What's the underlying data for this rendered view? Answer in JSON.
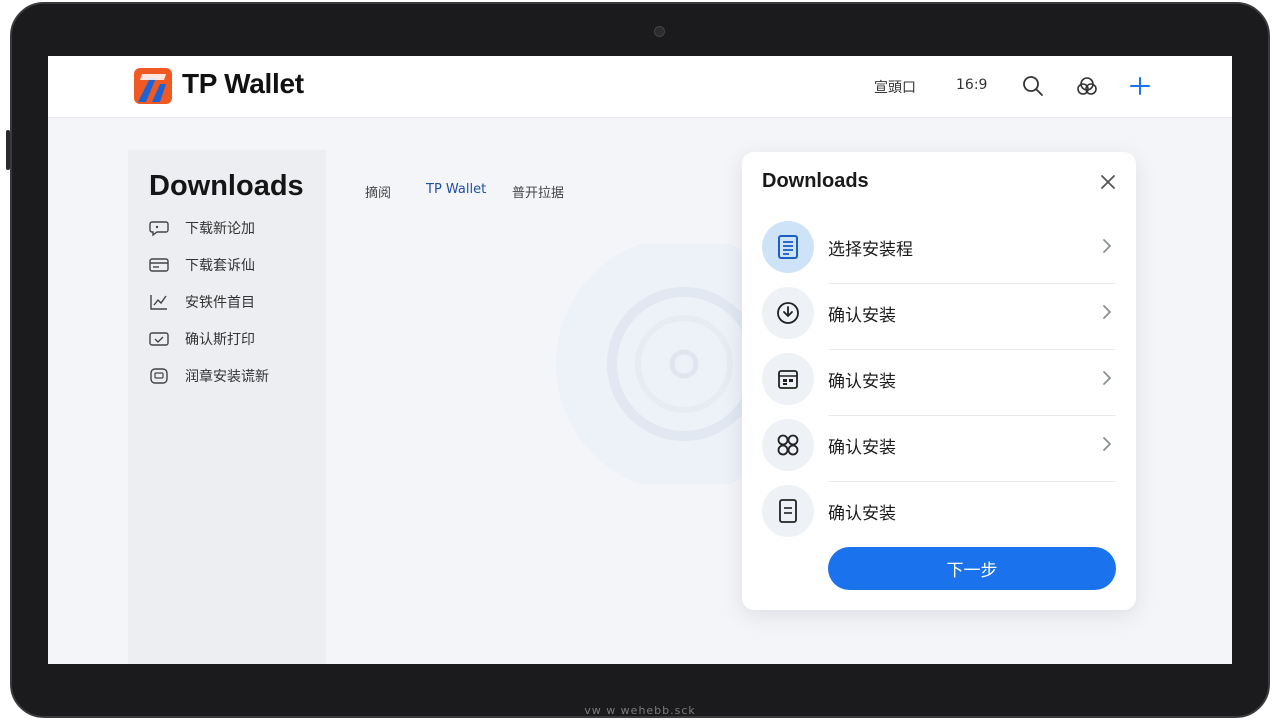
{
  "app": {
    "brand": "TP Wallet"
  },
  "topbar": {
    "links": [
      "宣頭口",
      "16:9"
    ],
    "icons": [
      "search-icon",
      "user-icon",
      "plus-icon"
    ]
  },
  "sidebar": {
    "title": "Downloads",
    "items": [
      {
        "label": "下载新论加",
        "icon": "chat-icon"
      },
      {
        "label": "下载套诉仙",
        "icon": "card-icon"
      },
      {
        "label": "安铁件首目",
        "icon": "chart-icon"
      },
      {
        "label": "确认斯打印",
        "icon": "message-check-icon"
      },
      {
        "label": "润章安装谎新",
        "icon": "device-icon"
      }
    ]
  },
  "tabs": [
    {
      "label": "摘阅",
      "active": false
    },
    {
      "label": "TP Wallet",
      "active": true
    },
    {
      "label": "普开拉据",
      "active": false
    }
  ],
  "panel": {
    "title": "Downloads",
    "items": [
      {
        "label": "选择安装程",
        "icon": "document-icon",
        "selected": true,
        "chevron": true
      },
      {
        "label": "确认安装",
        "icon": "download-icon",
        "selected": false,
        "chevron": true
      },
      {
        "label": "确认安装",
        "icon": "calendar-icon",
        "selected": false,
        "chevron": true
      },
      {
        "label": "确认安装",
        "icon": "apps-icon",
        "selected": false,
        "chevron": true
      },
      {
        "label": "确认安装",
        "icon": "file-icon",
        "selected": false,
        "chevron": false
      }
    ],
    "next_label": "下一步"
  },
  "device": {
    "footer_text": "vw w wehebb.sck"
  },
  "colors": {
    "accent": "#1a73ec",
    "selected_circle": "#cfe3f8",
    "logo_orange": "#f05a22",
    "logo_blue": "#1e63d6"
  }
}
